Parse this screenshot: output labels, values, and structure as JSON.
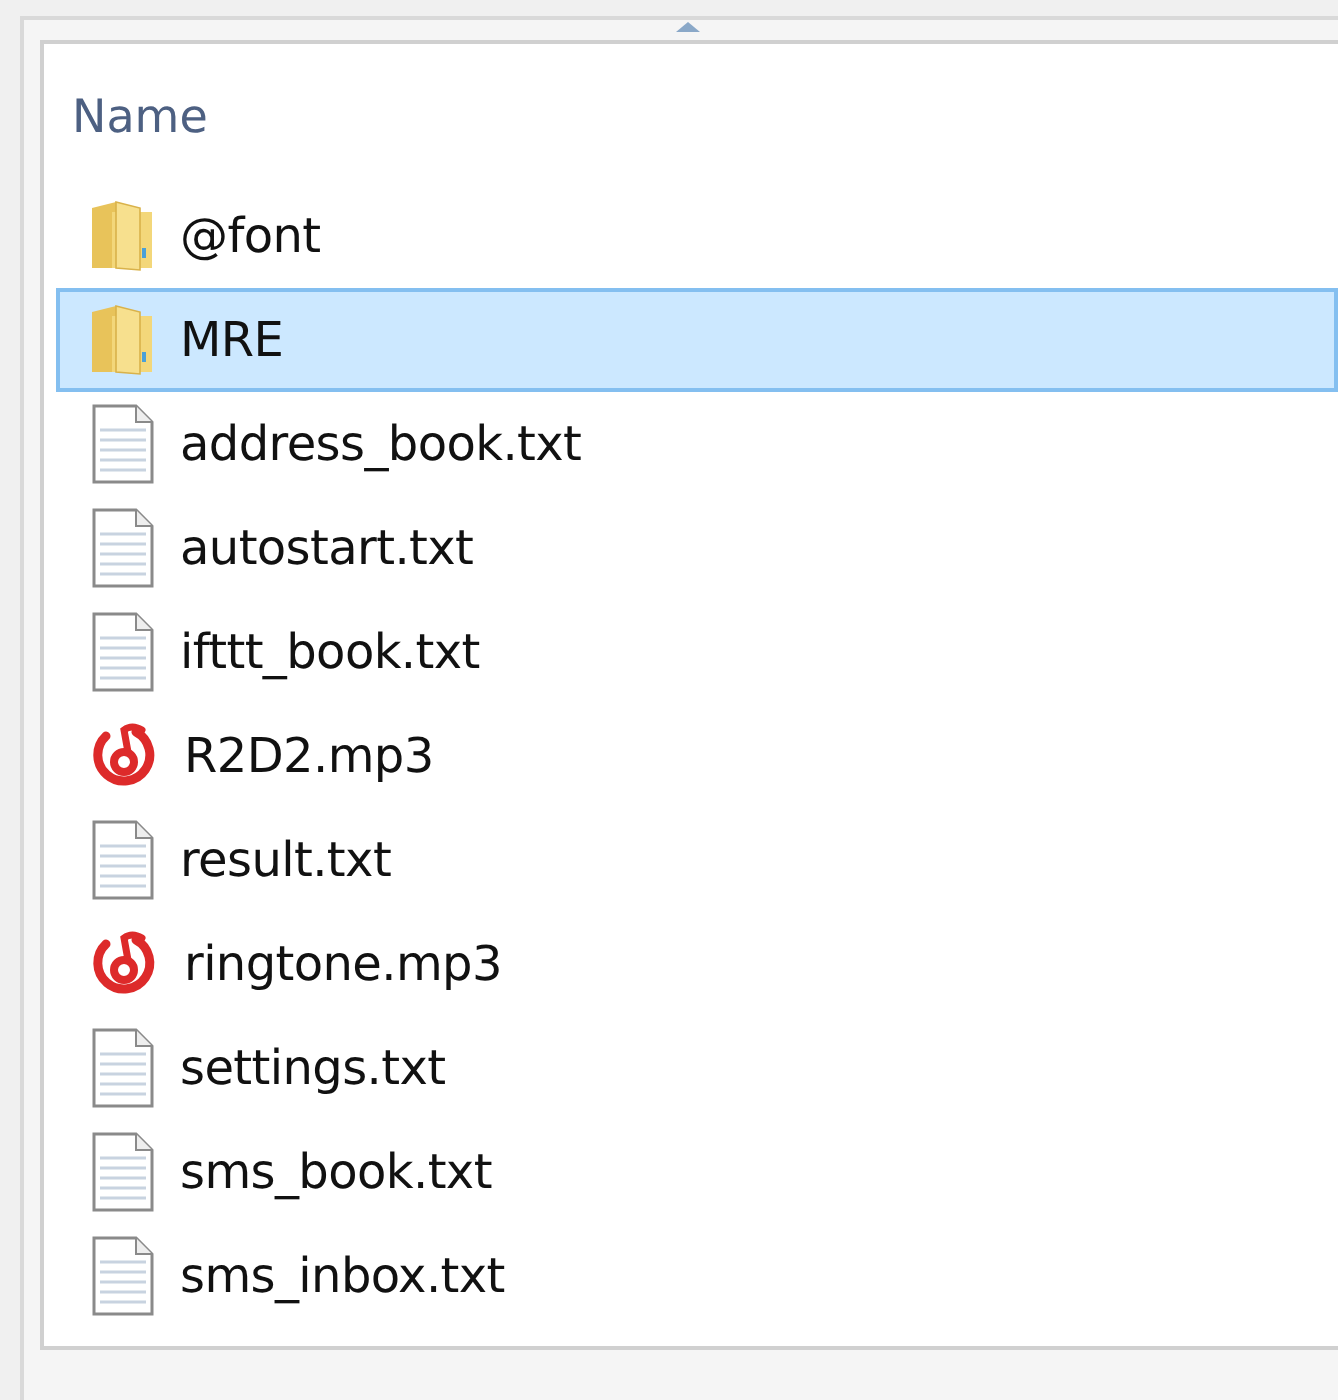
{
  "column_header": {
    "label": "Name"
  },
  "files": [
    {
      "name": "@font",
      "kind": "folder",
      "selected": false
    },
    {
      "name": "MRE",
      "kind": "folder",
      "selected": true
    },
    {
      "name": "address_book.txt",
      "kind": "text",
      "selected": false
    },
    {
      "name": "autostart.txt",
      "kind": "text",
      "selected": false
    },
    {
      "name": "ifttt_book.txt",
      "kind": "text",
      "selected": false
    },
    {
      "name": "R2D2.mp3",
      "kind": "audio",
      "selected": false
    },
    {
      "name": "result.txt",
      "kind": "text",
      "selected": false
    },
    {
      "name": "ringtone.mp3",
      "kind": "audio",
      "selected": false
    },
    {
      "name": "settings.txt",
      "kind": "text",
      "selected": false
    },
    {
      "name": "sms_book.txt",
      "kind": "text",
      "selected": false
    },
    {
      "name": "sms_inbox.txt",
      "kind": "text",
      "selected": false
    }
  ]
}
